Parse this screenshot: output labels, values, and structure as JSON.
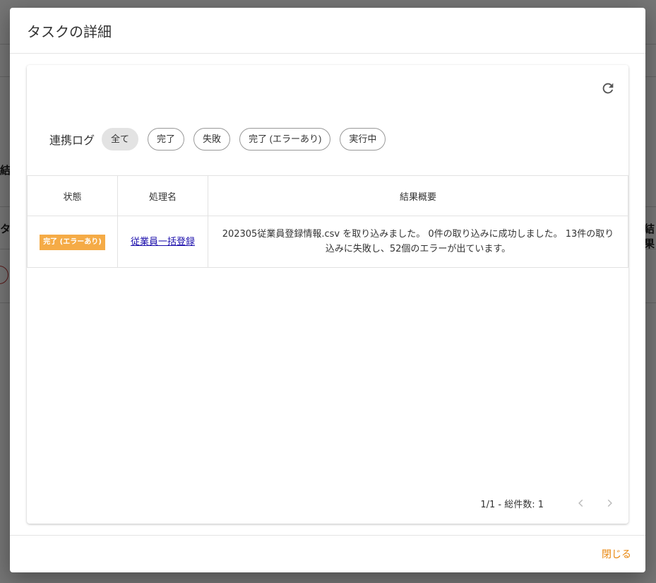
{
  "background": {
    "fragments": [
      "結",
      "タス",
      "結果"
    ]
  },
  "dialog": {
    "title": "タスクの詳細",
    "close_label": "閉じる"
  },
  "filter": {
    "label": "連携ログ",
    "chips": [
      {
        "label": "全て",
        "active": true
      },
      {
        "label": "完了",
        "active": false
      },
      {
        "label": "失敗",
        "active": false
      },
      {
        "label": "完了 (エラーあり)",
        "active": false
      },
      {
        "label": "実行中",
        "active": false
      }
    ]
  },
  "table": {
    "headers": [
      "状態",
      "処理名",
      "結果概要"
    ],
    "rows": [
      {
        "status": "完了 (エラーあり)",
        "status_color": "#f5ab46",
        "process": "従業員一括登録",
        "summary": "202305従業員登録情報.csv を取り込みました。 0件の取り込みに成功しました。 13件の取り込みに失敗し、52個のエラーが出ています。"
      }
    ]
  },
  "pagination": {
    "info": "1/1 - 総件数: 1"
  },
  "icons": {
    "refresh": "refresh-icon",
    "prev": "chevron-left-icon",
    "next": "chevron-right-icon"
  },
  "colors": {
    "accent": "#e8860c",
    "badge": "#f5ab46",
    "link": "#1a0dab"
  }
}
